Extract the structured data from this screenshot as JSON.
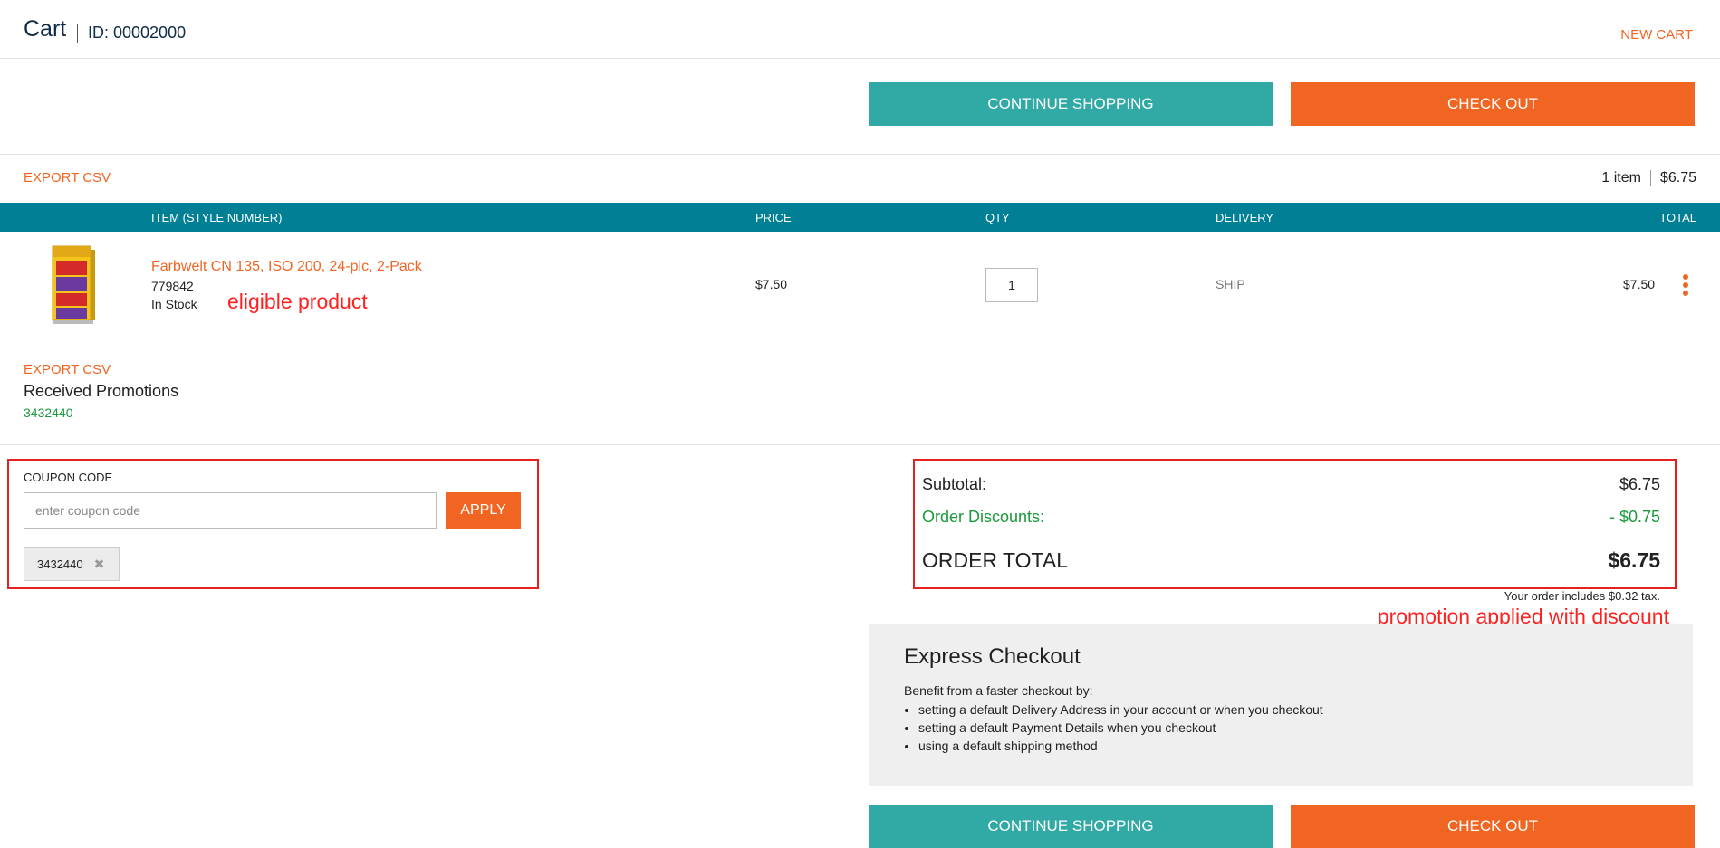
{
  "header": {
    "title": "Cart",
    "id_label": "ID: 00002000",
    "new_cart": "NEW CART"
  },
  "actions": {
    "continue_shopping": "CONTINUE SHOPPING",
    "check_out": "CHECK OUT"
  },
  "list_bar": {
    "export_csv": "EXPORT CSV",
    "item_count": "1 item",
    "subtotal": "$6.75"
  },
  "table": {
    "columns": [
      "ITEM (STYLE NUMBER)",
      "PRICE",
      "QTY",
      "DELIVERY",
      "TOTAL"
    ],
    "rows": [
      {
        "name": "Farbwelt CN 135, ISO 200, 24-pic, 2-Pack",
        "code": "779842",
        "stock": "In Stock",
        "price": "$7.50",
        "qty": "1",
        "delivery": "SHIP",
        "total": "$7.50",
        "image_icon": "film-pack-product-image"
      }
    ]
  },
  "promotions": {
    "export_csv": "EXPORT CSV",
    "title": "Received Promotions",
    "codes": [
      "3432440"
    ]
  },
  "coupon": {
    "label": "COUPON CODE",
    "placeholder": "enter coupon code",
    "apply": "APPLY",
    "applied": [
      "3432440"
    ],
    "remove_icon": "close-icon"
  },
  "totals": {
    "subtotal_label": "Subtotal:",
    "subtotal_value": "$6.75",
    "discount_label": "Order Discounts:",
    "discount_value": "- $0.75",
    "order_total_label": "ORDER TOTAL",
    "order_total_value": "$6.75",
    "tax_note": "Your order includes $0.32 tax."
  },
  "express": {
    "title": "Express Checkout",
    "subtitle": "Benefit from a faster checkout by:",
    "items": [
      "setting a default Delivery Address in your account or when you checkout",
      "setting a default Payment Details when you checkout",
      "using a default shipping method"
    ]
  },
  "annotations": {
    "eligible": "eligible product",
    "promo_applied": "promotion applied with discount"
  },
  "colors": {
    "accent": "#f06522",
    "teal_button": "#31aaa6",
    "table_header": "#007f95",
    "discount_green": "#1a9a3c",
    "annotation_red": "#e52222"
  }
}
